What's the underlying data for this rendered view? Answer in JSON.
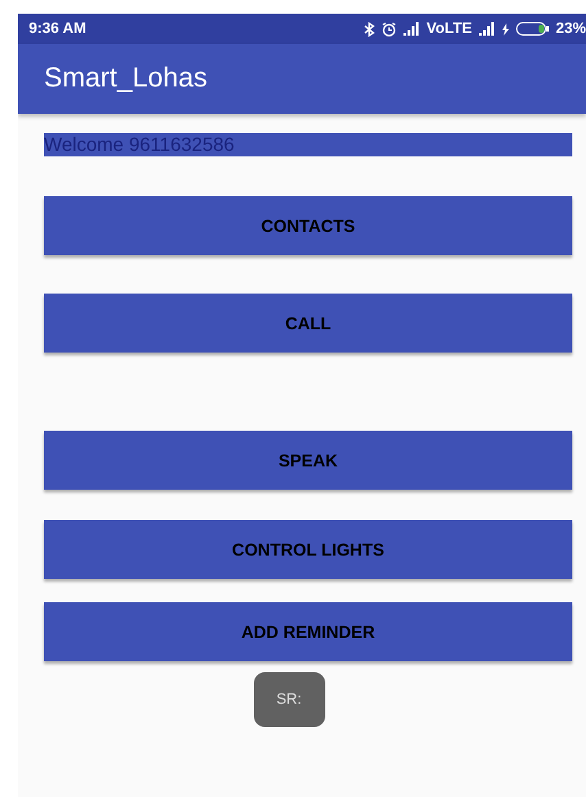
{
  "status_bar": {
    "time": "9:36 AM",
    "network": "VoLTE",
    "battery": "23%"
  },
  "app_bar": {
    "title": "Smart_Lohas"
  },
  "welcome": "Welcome 9611632586",
  "buttons": [
    {
      "label": "CONTACTS"
    },
    {
      "label": "CALL"
    },
    {
      "label": "SPEAK"
    },
    {
      "label": "CONTROL LIGHTS"
    },
    {
      "label": "ADD REMINDER"
    }
  ],
  "toast": "SR:"
}
